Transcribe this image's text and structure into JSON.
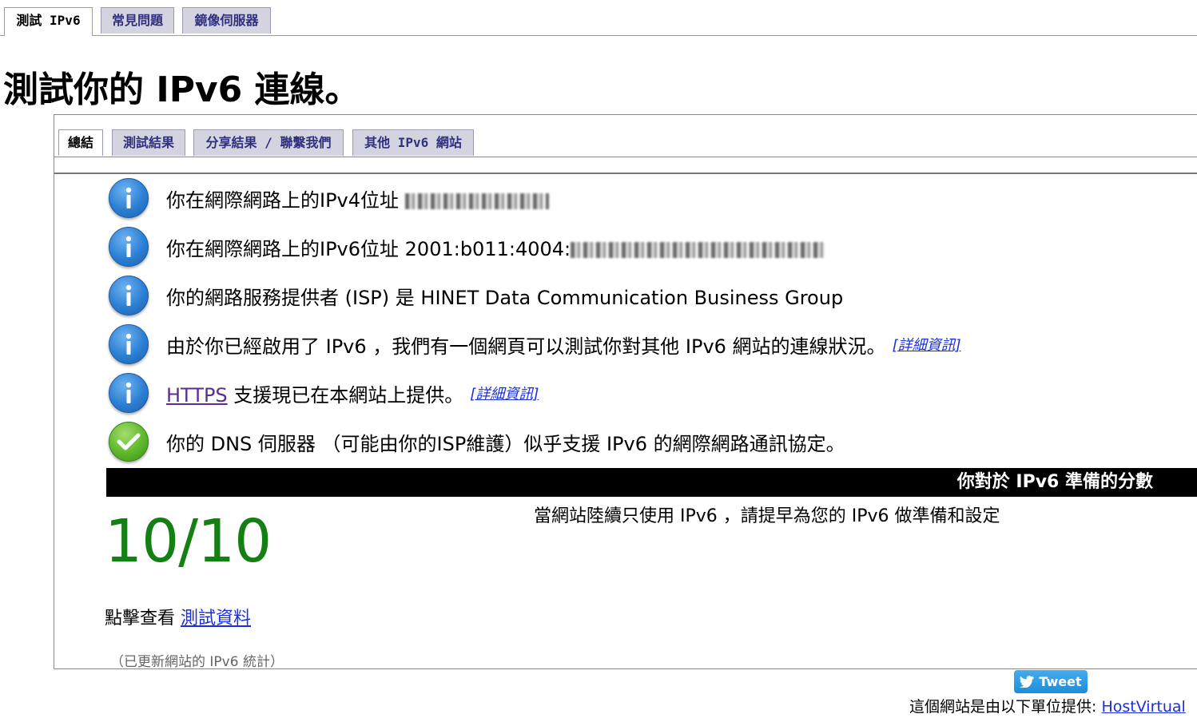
{
  "top_tabs": [
    {
      "label": "測試 IPv6",
      "active": true
    },
    {
      "label": "常見問題",
      "active": false
    },
    {
      "label": "鏡像伺服器",
      "active": false
    }
  ],
  "page_title": "測試你的 IPv6 連線。",
  "inner_tabs": [
    {
      "label": "總結",
      "active": true
    },
    {
      "label": "測試結果",
      "active": false
    },
    {
      "label": "分享結果 / 聯繫我們",
      "active": false
    },
    {
      "label": "其他 IPv6 網站",
      "active": false
    }
  ],
  "rows": [
    {
      "icon": "info-icon",
      "text": "你在網際網路上的IPv4位址 "
    },
    {
      "icon": "info-icon",
      "text": "你在網際網路上的IPv6位址 2001:b011:4004:"
    },
    {
      "icon": "info-icon",
      "text": "你的網路服務提供者 (ISP) 是 HINET Data Communication Business Group"
    },
    {
      "icon": "info-icon",
      "text": "由於你已經啟用了 IPv6 ，我們有一個網頁可以測試你對其他 IPv6 網站的連線狀況。",
      "detail": "[詳細資訊]"
    },
    {
      "icon": "info-icon",
      "link": "HTTPS",
      "text": " 支援現已在本網站上提供。",
      "detail": "[詳細資訊]"
    },
    {
      "icon": "check-icon",
      "text": "你的 DNS 伺服器 （可能由你的ISP維護）似乎支援 IPv6 的網際網路通訊協定。"
    }
  ],
  "score": {
    "heading": "你對於 IPv6 準備的分數",
    "value": "10/10",
    "note": "當網站陸續只使用 IPv6 ，請提早為您的 IPv6 做準備和設定"
  },
  "click_see": {
    "prefix": "點擊查看 ",
    "link": "測試資料"
  },
  "updated_note": "（已更新網站的 IPv6 統計）",
  "tweet_label": "Tweet",
  "footer": {
    "prefix": "這個網站是由以下單位提供: ",
    "link": "HostVirtual"
  },
  "colors": {
    "score": "#148014",
    "link": "#1a2edb",
    "tab_bg": "#d4d4e0",
    "tweet": "#1d9bf0"
  }
}
